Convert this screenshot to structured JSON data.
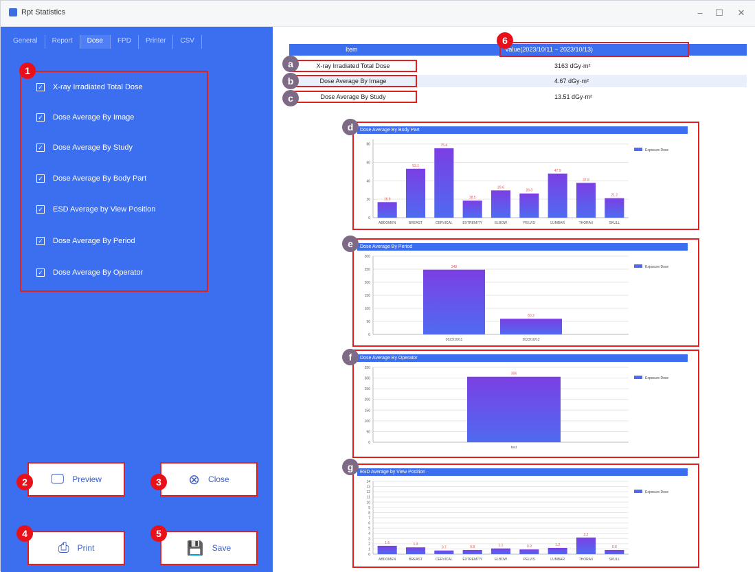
{
  "window": {
    "title": "Rpt Statistics",
    "minimize": "–",
    "maximize": "☐",
    "close": "✕"
  },
  "tabs": [
    "General",
    "Report",
    "Dose",
    "FPD",
    "Printer",
    "CSV"
  ],
  "active_tab": "Dose",
  "options": [
    "X-ray Irradiated Total Dose",
    "Dose Average By Image",
    "Dose Average By Study",
    "Dose Average By Body Part",
    "ESD Average by View Position",
    "Dose Average By Period",
    "Dose Average By Operator"
  ],
  "buttons": {
    "preview": "Preview",
    "close": "Close",
    "print": "Print",
    "save": "Save"
  },
  "summary": {
    "header_item": "Item",
    "header_value": "Value(2023/10/11 ~ 2023/10/13)",
    "rows": [
      {
        "label": "X-ray Irradiated Total Dose",
        "value": "3163 dGy·m²"
      },
      {
        "label": "Dose Average By Image",
        "value": "4.67 dGy·m²"
      },
      {
        "label": "Dose Average By Study",
        "value": "13.51 dGy·m²"
      }
    ]
  },
  "badges": {
    "n1": "1",
    "n2": "2",
    "n3": "3",
    "n4": "4",
    "n5": "5",
    "n6": "6",
    "a": "a",
    "b": "b",
    "c": "c",
    "d": "d",
    "e": "e",
    "f": "f",
    "g": "g"
  },
  "chart_data": [
    {
      "type": "bar",
      "title": "Dose Average By Body Part",
      "legend": "Exposure Dose",
      "categories": [
        "ABDOMEN",
        "BREAST",
        "CERVICAL",
        "EXTREMITY",
        "ELBOW",
        "PELVIS",
        "LUMBAR",
        "THORAX",
        "SKULL"
      ],
      "category_labels": [
        "ABDOMEN",
        "BREAST",
        "CERVICAL",
        "EXTREMITY",
        "ELBOW",
        "PELVIS",
        "LUMBAR",
        "THORAX",
        "SKULL"
      ],
      "values": [
        16.9,
        53.1,
        75.4,
        18.5,
        29.6,
        26.3,
        47.9,
        37.8,
        21.2
      ],
      "data_labels": [
        "16.9",
        "53.1",
        "75.4",
        "18.5",
        "29.6",
        "26.3",
        "47.9",
        "37.8",
        "21.2"
      ],
      "yticks": [
        0,
        20,
        40,
        60,
        80
      ],
      "ylim": [
        0,
        85
      ]
    },
    {
      "type": "bar",
      "title": "Dose Average By Period",
      "legend": "Exposure Dose",
      "categories": [
        "2023/10/11",
        "2023/10/12"
      ],
      "values": [
        248,
        60.2
      ],
      "data_labels": [
        "248",
        "60.2"
      ],
      "yticks": [
        0,
        50,
        100,
        150,
        200,
        250,
        300
      ],
      "ylim": [
        0,
        300
      ]
    },
    {
      "type": "bar",
      "title": "Dose Average By Operator",
      "legend": "Exposure Dose",
      "categories": [
        "test"
      ],
      "values": [
        306
      ],
      "data_labels": [
        "306"
      ],
      "yticks": [
        0,
        50,
        100,
        150,
        200,
        250,
        300,
        350
      ],
      "ylim": [
        0,
        350
      ]
    },
    {
      "type": "bar",
      "title": "ESD Average by View Position",
      "legend": "Exposure Dose",
      "categories": [
        "ABDOMEN",
        "BREAST",
        "CERVICAL",
        "EXTREMITY",
        "ELBOW",
        "PELVIS",
        "LUMBAR",
        "THORAX",
        "SKULL"
      ],
      "values": [
        1.6,
        1.3,
        0.7,
        0.8,
        1.1,
        0.9,
        1.2,
        3.2,
        0.8
      ],
      "data_labels": [
        "1.6",
        "1.3",
        "0.7",
        "0.8",
        "1.1",
        "0.9",
        "1.2",
        "3.2",
        "0.8"
      ],
      "yticks": [
        0,
        1,
        2,
        3,
        4,
        5,
        6,
        7,
        8,
        9,
        10,
        11,
        12,
        13,
        14
      ],
      "ylim": [
        0,
        14
      ]
    }
  ],
  "colors": {
    "accent": "#3c6ef0",
    "highlight": "#e02020",
    "bar_top": "#7b3fe4",
    "bar_bottom": "#4f6bf0",
    "label_red": "#e65050"
  }
}
